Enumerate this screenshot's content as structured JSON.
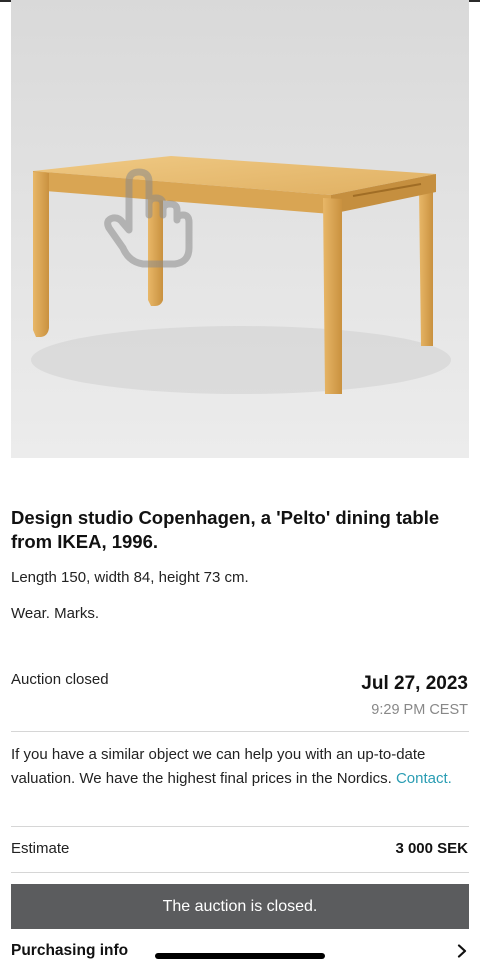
{
  "lot": {
    "title": "Design studio Copenhagen, a 'Pelto' dining table from IKEA, 1996.",
    "dimensions": "Length 150, width 84, height 73 cm.",
    "condition": "Wear. Marks."
  },
  "auction": {
    "status_label": "Auction closed",
    "date": "Jul 27, 2023",
    "time": "9:29 PM CEST"
  },
  "valuation": {
    "text": "If you have a similar object we can help you with an up-to-date valuation. We have the highest final prices in the Nordics.",
    "link_label": "Contact."
  },
  "estimate": {
    "label": "Estimate",
    "value": "3 000 SEK"
  },
  "banner": {
    "text": "The auction is closed."
  },
  "purchasing": {
    "label": "Purchasing info",
    "icon": "chevron-right-icon"
  },
  "icons": {
    "photo_overlay": "tap-hand-icon"
  },
  "colors": {
    "link": "#2a9db3",
    "banner_bg": "#5b5c5e",
    "muted_text": "#888888"
  }
}
